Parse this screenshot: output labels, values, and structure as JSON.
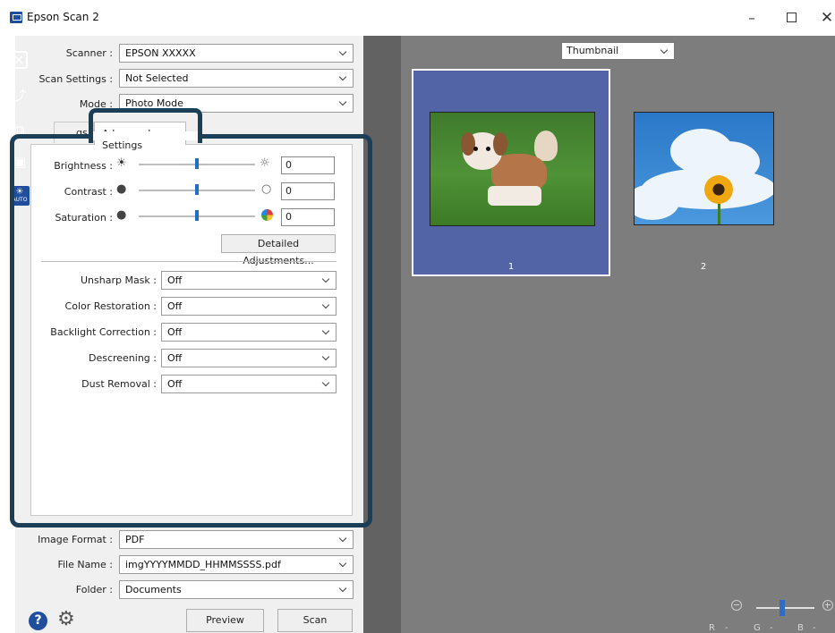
{
  "window": {
    "title": "Epson Scan 2",
    "minimize": "–",
    "maximize": "",
    "close": "✕"
  },
  "scanner": {
    "label": "Scanner :",
    "value": "EPSON XXXXX"
  },
  "scan_settings": {
    "label": "Scan Settings :",
    "value": "Not Selected"
  },
  "mode": {
    "label": "Mode :",
    "value": "Photo Mode"
  },
  "tabs": [
    {
      "label": "Main Settings",
      "visible_text": "gs",
      "active": false
    },
    {
      "label": "Advanced Settings",
      "active": true
    }
  ],
  "brightness": {
    "label": "Brightness :",
    "value": "0",
    "level": 0.5
  },
  "contrast": {
    "label": "Contrast :",
    "value": "0",
    "level": 0.5
  },
  "saturation": {
    "label": "Saturation :",
    "value": "0",
    "level": 0.5
  },
  "detailed_adjustments": "Detailed Adjustments...",
  "options": [
    {
      "label": "Unsharp Mask :",
      "value": "Off"
    },
    {
      "label": "Color Restoration :",
      "value": "Off"
    },
    {
      "label": "Backlight Correction :",
      "value": "Off"
    },
    {
      "label": "Descreening :",
      "value": "Off"
    },
    {
      "label": "Dust Removal :",
      "value": "Off"
    }
  ],
  "image_format": {
    "label": "Image Format :",
    "value": "PDF"
  },
  "file_name": {
    "label": "File Name :",
    "value": "imgYYYYMMDD_HHMMSSSS.pdf"
  },
  "folder": {
    "label": "Folder :",
    "value": "Documents"
  },
  "buttons": {
    "preview": "Preview",
    "scan": "Scan"
  },
  "help_icon_text": "?",
  "gear_icon_text": "⚙",
  "preview": {
    "view_mode": "Thumbnail",
    "thumbnails": [
      {
        "label": "1",
        "selected": true,
        "subject": "dog"
      },
      {
        "label": "2",
        "selected": false,
        "subject": "sunflower-sky"
      }
    ]
  },
  "zoom": {
    "level": 0.45
  },
  "channels": {
    "r": "R",
    "g": "G",
    "b": "B",
    "sep": "-"
  },
  "colors": {
    "accent": "#1f4f9c",
    "highlight_outline": "#1a3f57",
    "preview_bg": "#7d7d7d",
    "toolbar_bg": "#626262",
    "selected_thumb": "#5364a6",
    "slider_thumb": "#1f6fc5"
  }
}
